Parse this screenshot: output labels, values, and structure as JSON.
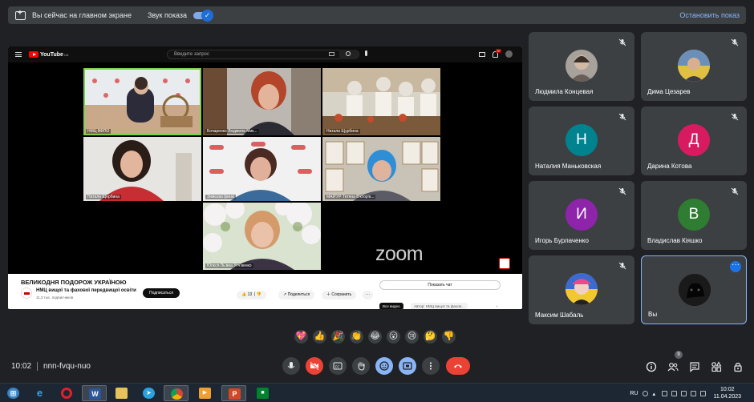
{
  "banner": {
    "presenting_text": "Вы сейчас на главном экране",
    "sound_label": "Звук показа",
    "stop_label": "Остановить показ"
  },
  "youtube": {
    "logo_text": "YouTube",
    "region": "UA",
    "search_placeholder": "Введите запрос",
    "notification_count": "9+",
    "video_title": "ВЕЛИКОДНЯ ПОДОРОЖ УКРАЇНОЮ",
    "channel_name": "НМЦ вищої та фахової передвищої освіти",
    "channel_subs": "11,3 тыс. подписчиков",
    "subscribe_label": "Подписаться",
    "likes": "13",
    "share_label": "Поделиться",
    "save_label": "Сохранить",
    "show_chat_label": "Показать чат",
    "chip_all": "Все видео",
    "chip_author": "Автор: НМЦ вищої та фахов..."
  },
  "zoom_grid": {
    "watermark": "zoom",
    "tiles": [
      {
        "name": "НМЦ ВФПО"
      },
      {
        "name": "Бочаренко Людмила Мик..."
      },
      {
        "name": "Натали Щурбина"
      },
      {
        "name": "Натали Щербина"
      },
      {
        "name": "Зимєєва Ірина"
      },
      {
        "name": "МАЙ'УР Тетяна В'ктор'в..."
      },
      {
        "name": "Юлєся Ль'вна Утч'венко"
      }
    ]
  },
  "participants": [
    {
      "name": "Людмила Концевая",
      "initial": "",
      "color": "#a7a39c"
    },
    {
      "name": "Дима Цезарев",
      "initial": "",
      "color": "#c9b26b"
    },
    {
      "name": "Наталия Маньковская",
      "initial": "Н",
      "color": "#00838f"
    },
    {
      "name": "Дарина Котова",
      "initial": "Д",
      "color": "#d81b60"
    },
    {
      "name": "Игорь Бурлаченко",
      "initial": "И",
      "color": "#8e24aa"
    },
    {
      "name": "Владислав Кіяшко",
      "initial": "В",
      "color": "#2e7d32"
    },
    {
      "name": "Максим Шабаль",
      "initial": "",
      "color": "#e0567b"
    },
    {
      "name": "Вы",
      "initial": "",
      "color": "#111111"
    }
  ],
  "reactions": [
    "💖",
    "👍",
    "🎉",
    "👏",
    "😂",
    "😮",
    "😢",
    "🤔",
    "👎"
  ],
  "meeting": {
    "time": "10:02",
    "code": "nnn-fvqu-nuo",
    "participant_count": "9"
  },
  "taskbar": {
    "lang": "RU",
    "time": "10:02",
    "date": "11.04.2023"
  }
}
